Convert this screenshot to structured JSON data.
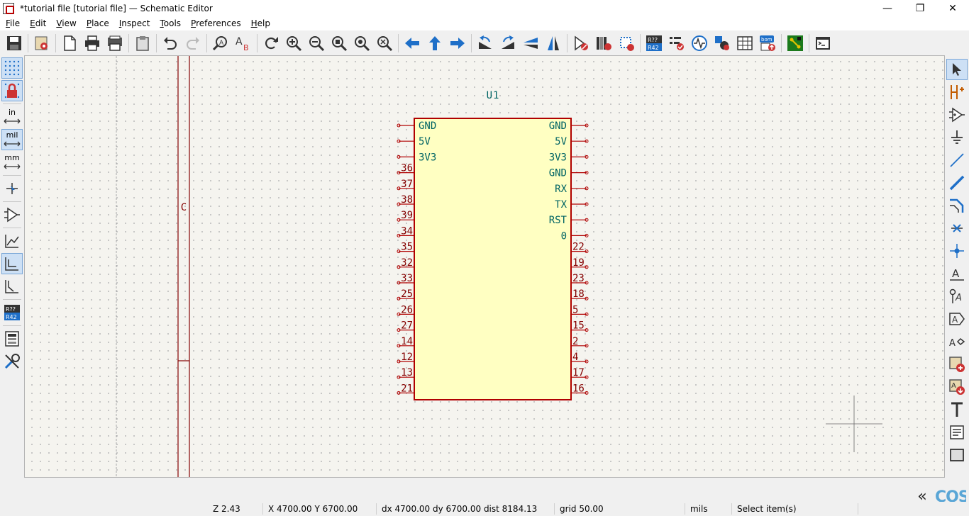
{
  "window": {
    "title": "*tutorial file [tutorial file] — Schematic Editor",
    "minimize": "—",
    "restore": "❐",
    "close": "✕"
  },
  "menu": [
    {
      "label": "File",
      "ul": "F",
      "rest": "ile"
    },
    {
      "label": "Edit",
      "ul": "E",
      "rest": "dit"
    },
    {
      "label": "View",
      "ul": "V",
      "rest": "iew"
    },
    {
      "label": "Place",
      "ul": "P",
      "rest": "lace"
    },
    {
      "label": "Inspect",
      "ul": "I",
      "rest": "nspect"
    },
    {
      "label": "Tools",
      "ul": "T",
      "rest": "ools"
    },
    {
      "label": "Preferences",
      "ul": "P",
      "rest": "references"
    },
    {
      "label": "Help",
      "ul": "H",
      "rest": "elp"
    }
  ],
  "left_toolbar": {
    "unit_in": "in",
    "unit_mil": "mil",
    "unit_mm": "mm",
    "annotate_top": "R??",
    "annotate_bottom": "R42"
  },
  "top_toolbar": {
    "annotate_top": "R??",
    "annotate_bottom": "R42",
    "bom_label": "bom"
  },
  "schematic": {
    "reference": "U1",
    "sheet_border_label": "C",
    "left_pins": [
      "GND",
      "5V",
      "3V3",
      "36",
      "37",
      "38",
      "39",
      "34",
      "35",
      "32",
      "33",
      "25",
      "26",
      "27",
      "14",
      "12",
      "13",
      "21"
    ],
    "right_pins": [
      "GND",
      "5V",
      "3V3",
      "GND",
      "RX",
      "TX",
      "RST",
      "0",
      "22",
      "19",
      "23",
      "18",
      "5",
      "15",
      "2",
      "4",
      "17",
      "16"
    ],
    "colors": {
      "body_fill": "#ffffc2",
      "body_stroke": "#b00000",
      "pin_text": "#006464",
      "ref_text": "#006464",
      "border": "#840000"
    }
  },
  "status": {
    "zoom": "Z 2.43",
    "coords": "X 4700.00  Y 6700.00",
    "delta": "dx 4700.00  dy 6700.00  dist 8184.13",
    "grid": "grid 50.00",
    "units": "mils",
    "mode": "Select item(s)"
  },
  "logo": "COS",
  "collapse_label": "«"
}
